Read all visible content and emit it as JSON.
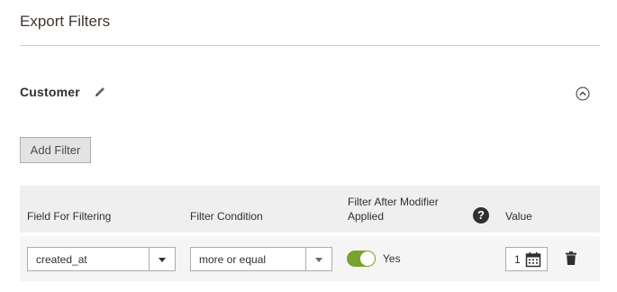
{
  "section": {
    "title": "Export Filters"
  },
  "group": {
    "title": "Customer",
    "edit_icon": "pencil-icon",
    "collapse_icon": "collapse-up-icon"
  },
  "actions": {
    "add_filter_label": "Add Filter"
  },
  "grid": {
    "columns": [
      "Field For Filtering",
      "Filter Condition",
      "Filter After Modifier Applied",
      "Value"
    ],
    "help_glyph": "?",
    "rows": [
      {
        "field": "created_at",
        "condition": "more or equal",
        "modifier_enabled": true,
        "modifier_label": "Yes",
        "value": "1",
        "date_icon": "calendar-icon",
        "delete_icon": "trash-icon"
      }
    ]
  },
  "colors": {
    "toggle_on": "#79a22e",
    "header_bg": "#efefef",
    "row_bg": "#f5f5f5",
    "button_bg": "#e3e3e3"
  }
}
